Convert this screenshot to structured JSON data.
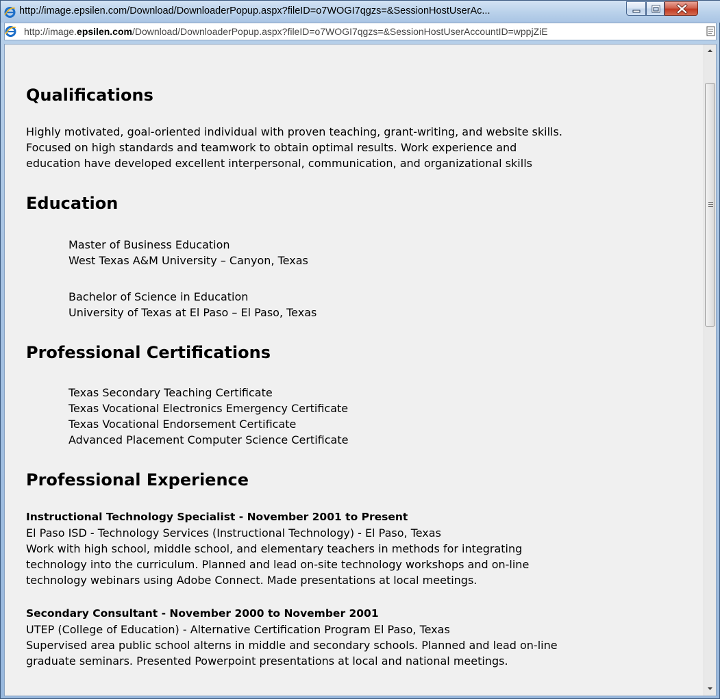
{
  "window": {
    "title": "http://image.epsilen.com/Download/DownloaderPopup.aspx?fileID=o7WOGI7qgzs=&SessionHostUserAc...",
    "controls": {
      "minimize": "minimize-button",
      "maximize": "maximize-button",
      "close": "close-button"
    }
  },
  "addressbar": {
    "url_prefix": "http://image.",
    "url_domain": "epsilen.com",
    "url_rest": "/Download/DownloaderPopup.aspx?fileID=o7WOGI7qgzs=&SessionHostUserAccountID=wppjZiE"
  },
  "document": {
    "qualifications": {
      "heading": "Qualifications",
      "lines": [
        "Highly motivated, goal-oriented individual with proven teaching, grant-writing, and website skills.",
        "Focused on high standards and teamwork to obtain optimal results.  Work experience and",
        "education have developed excellent interpersonal, communication, and organizational skills"
      ]
    },
    "education": {
      "heading": "Education",
      "degrees": [
        {
          "degree": "Master of Business Education",
          "school": "West Texas A&M University – Canyon, Texas"
        },
        {
          "degree": "Bachelor of Science in Education",
          "school": "University of Texas at El Paso – El Paso, Texas"
        }
      ]
    },
    "certifications": {
      "heading": "Professional Certifications",
      "items": [
        "Texas Secondary Teaching Certificate",
        "Texas Vocational Electronics Emergency Certificate",
        "Texas Vocational Endorsement Certificate",
        "Advanced Placement Computer Science Certificate"
      ]
    },
    "experience": {
      "heading": "Professional Experience",
      "jobs": [
        {
          "title": "Instructional Technology Specialist - November 2001 to Present",
          "employer": "El Paso ISD - Technology Services (Instructional Technology) - El Paso, Texas",
          "lines": [
            "Work with high school, middle school, and elementary teachers in methods for integrating",
            "technology into the curriculum. Planned and lead on-site technology workshops and on-line",
            "technology webinars using Adobe Connect.  Made presentations at local meetings."
          ]
        },
        {
          "title": "Secondary Consultant - November 2000 to November 2001",
          "employer": "UTEP (College of Education) - Alternative Certification Program El Paso, Texas",
          "lines": [
            "Supervised area public school alterns in middle and secondary schools.  Planned and lead on-line",
            "graduate seminars.  Presented Powerpoint presentations at local and national meetings."
          ]
        }
      ]
    }
  },
  "colors": {
    "titlebar": "#b9d1ea",
    "content_bg": "#f0f0f0",
    "close_red": "#c23a22",
    "ie_blue": "#1e6fc8"
  }
}
